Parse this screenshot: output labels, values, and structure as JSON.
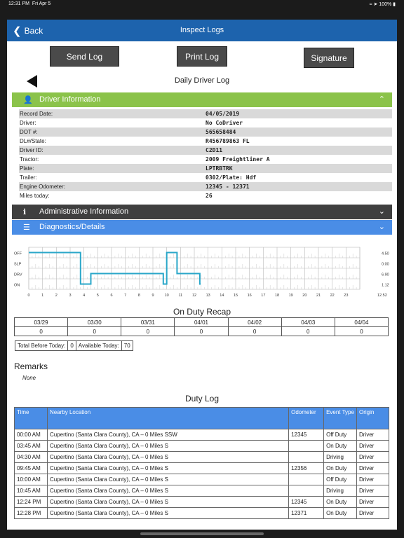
{
  "status": {
    "time": "12:31 PM",
    "date": "Fri Apr 5",
    "battery": "100%",
    "icons": "wifi-icon location-icon battery-icon"
  },
  "nav": {
    "back_label": "Back",
    "title": "Inspect Logs"
  },
  "toolbar": {
    "send_log": "Send Log",
    "print_log": "Print Log",
    "signature": "Signature"
  },
  "log_title": "Daily Driver Log",
  "sections": {
    "driver": "Driver Information",
    "admin": "Administrative Information",
    "diagnostics": "Diagnostics/Details"
  },
  "driver_info": [
    {
      "label": "Record Date:",
      "value": "04/05/2019"
    },
    {
      "label": "Driver:",
      "value": "No CoDriver"
    },
    {
      "label": "DOT #:",
      "value": "565658484"
    },
    {
      "label": "DL#/State:",
      "value": "R456789863 FL"
    },
    {
      "label": "Driver ID:",
      "value": "C2D11"
    },
    {
      "label": "Tractor:",
      "value": "2009 Freightliner A"
    },
    {
      "label": "Plate:",
      "value": "LPTRBTRK"
    },
    {
      "label": "Trailer:",
      "value": "0302/Plate: Hdf"
    },
    {
      "label": "Engine Odometer:",
      "value": "12345 - 12371"
    },
    {
      "label": "Miles today:",
      "value": "26"
    }
  ],
  "chart_data": {
    "type": "line",
    "rows": [
      "OFF",
      "SLP",
      "DRV",
      "ON"
    ],
    "x_ticks": [
      "0",
      "1",
      "2",
      "3",
      "4",
      "5",
      "6",
      "7",
      "8",
      "9",
      "10",
      "11",
      "12",
      "13",
      "14",
      "15",
      "16",
      "17",
      "18",
      "19",
      "20",
      "21",
      "22",
      "23"
    ],
    "x_range": [
      0,
      24
    ],
    "totals": [
      "4.50",
      "0.00",
      "6.90",
      "1.12"
    ],
    "total_sum": "12.52",
    "steps": [
      {
        "status": "OFF",
        "from": 0.0,
        "to": 3.75
      },
      {
        "status": "ON",
        "from": 3.75,
        "to": 4.5
      },
      {
        "status": "DRV",
        "from": 4.5,
        "to": 9.75
      },
      {
        "status": "ON",
        "from": 9.75,
        "to": 10.0
      },
      {
        "status": "OFF",
        "from": 10.0,
        "to": 10.75
      },
      {
        "status": "DRV",
        "from": 10.75,
        "to": 12.4
      },
      {
        "status": "ON",
        "from": 12.4,
        "to": 12.47
      }
    ],
    "line_color": "#2aa7c9"
  },
  "recap": {
    "title": "On Duty Recap",
    "days": [
      "03/29",
      "03/30",
      "03/31",
      "04/01",
      "04/02",
      "04/03",
      "04/04"
    ],
    "values": [
      "0",
      "0",
      "0",
      "0",
      "0",
      "0",
      "0"
    ],
    "total_before_label": "Total Before Today:",
    "total_before_value": "0",
    "available_label": "Available Today:",
    "available_value": "70"
  },
  "remarks": {
    "title": "Remarks",
    "value": "None"
  },
  "duty_log": {
    "title": "Duty Log",
    "headers": [
      "Time",
      "Nearby Location",
      "Odometer",
      "Event Type",
      "Origin"
    ],
    "rows": [
      [
        "00:00 AM",
        "Cupertino (Santa Clara County), CA – 0 Miles SSW",
        "12345",
        "Off Duty",
        "Driver"
      ],
      [
        "03:45 AM",
        "Cupertino (Santa Clara County), CA – 0 Miles S",
        "",
        "On Duty",
        "Driver"
      ],
      [
        "04:30 AM",
        "Cupertino (Santa Clara County), CA – 0 Miles S",
        "",
        "Driving",
        "Driver"
      ],
      [
        "09:45 AM",
        "Cupertino (Santa Clara County), CA – 0 Miles S",
        "12356",
        "On Duty",
        "Driver"
      ],
      [
        "10:00 AM",
        "Cupertino (Santa Clara County), CA – 0 Miles S",
        "",
        "Off Duty",
        "Driver"
      ],
      [
        "10:45 AM",
        "Cupertino (Santa Clara County), CA – 0 Miles S",
        "",
        "Driving",
        "Driver"
      ],
      [
        "12:24 PM",
        "Cupertino (Santa Clara County), CA – 0 Miles S",
        "12345",
        "On Duty",
        "Driver"
      ],
      [
        "12:28 PM",
        "Cupertino (Santa Clara County), CA – 0 Miles S",
        "12371",
        "On Duty",
        "Driver"
      ]
    ]
  }
}
